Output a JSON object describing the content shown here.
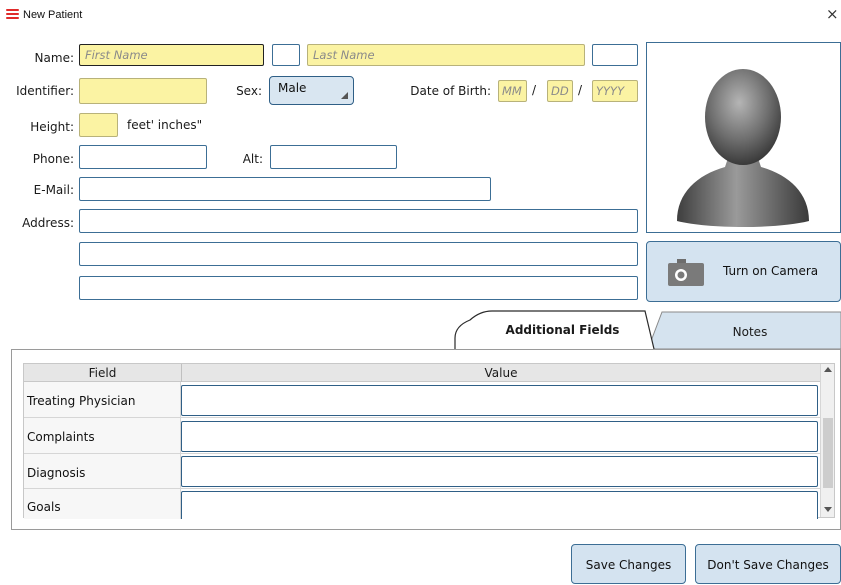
{
  "window": {
    "title": "New Patient",
    "close_glyph": "×",
    "icon": "hamburger-icon",
    "icon_color": "#e02a2a"
  },
  "form": {
    "name_label": "Name:",
    "first_name_placeholder": "First Name",
    "middle_initial_value": "",
    "last_name_placeholder": "Last Name",
    "suffix_value": "",
    "identifier_label": "Identifier:",
    "identifier_value": "",
    "sex_label": "Sex:",
    "sex_value": "Male",
    "dob_label": "Date of Birth:",
    "dob_mm_placeholder": "MM",
    "dob_dd_placeholder": "DD",
    "dob_yyyy_placeholder": "YYYY",
    "dob_sep": "/",
    "height_label": "Height:",
    "height_value": "",
    "height_units": "feet' inches\"",
    "phone_label": "Phone:",
    "phone_value": "",
    "alt_label": "Alt:",
    "alt_value": "",
    "email_label": "E-Mail:",
    "email_value": "",
    "address_label": "Address:",
    "address_lines": [
      "",
      "",
      ""
    ]
  },
  "photo": {
    "avatar_icon": "person-silhouette-icon",
    "camera_button_label": "Turn on Camera",
    "camera_icon": "camera-icon"
  },
  "tabs": [
    {
      "label": "Additional Fields",
      "active": true
    },
    {
      "label": "Notes",
      "active": false
    }
  ],
  "additional_fields": {
    "columns": [
      "Field",
      "Value"
    ],
    "rows": [
      {
        "field": "Treating Physician",
        "value": ""
      },
      {
        "field": "Complaints",
        "value": ""
      },
      {
        "field": "Diagnosis",
        "value": ""
      },
      {
        "field": "Goals",
        "value": ""
      }
    ]
  },
  "footer": {
    "save_label": "Save Changes",
    "dont_save_label": "Don't Save Changes"
  },
  "colors": {
    "accent_border": "#3c6e95",
    "required_field_bg": "#fbf3a3",
    "button_bg": "#d4e3f0"
  }
}
